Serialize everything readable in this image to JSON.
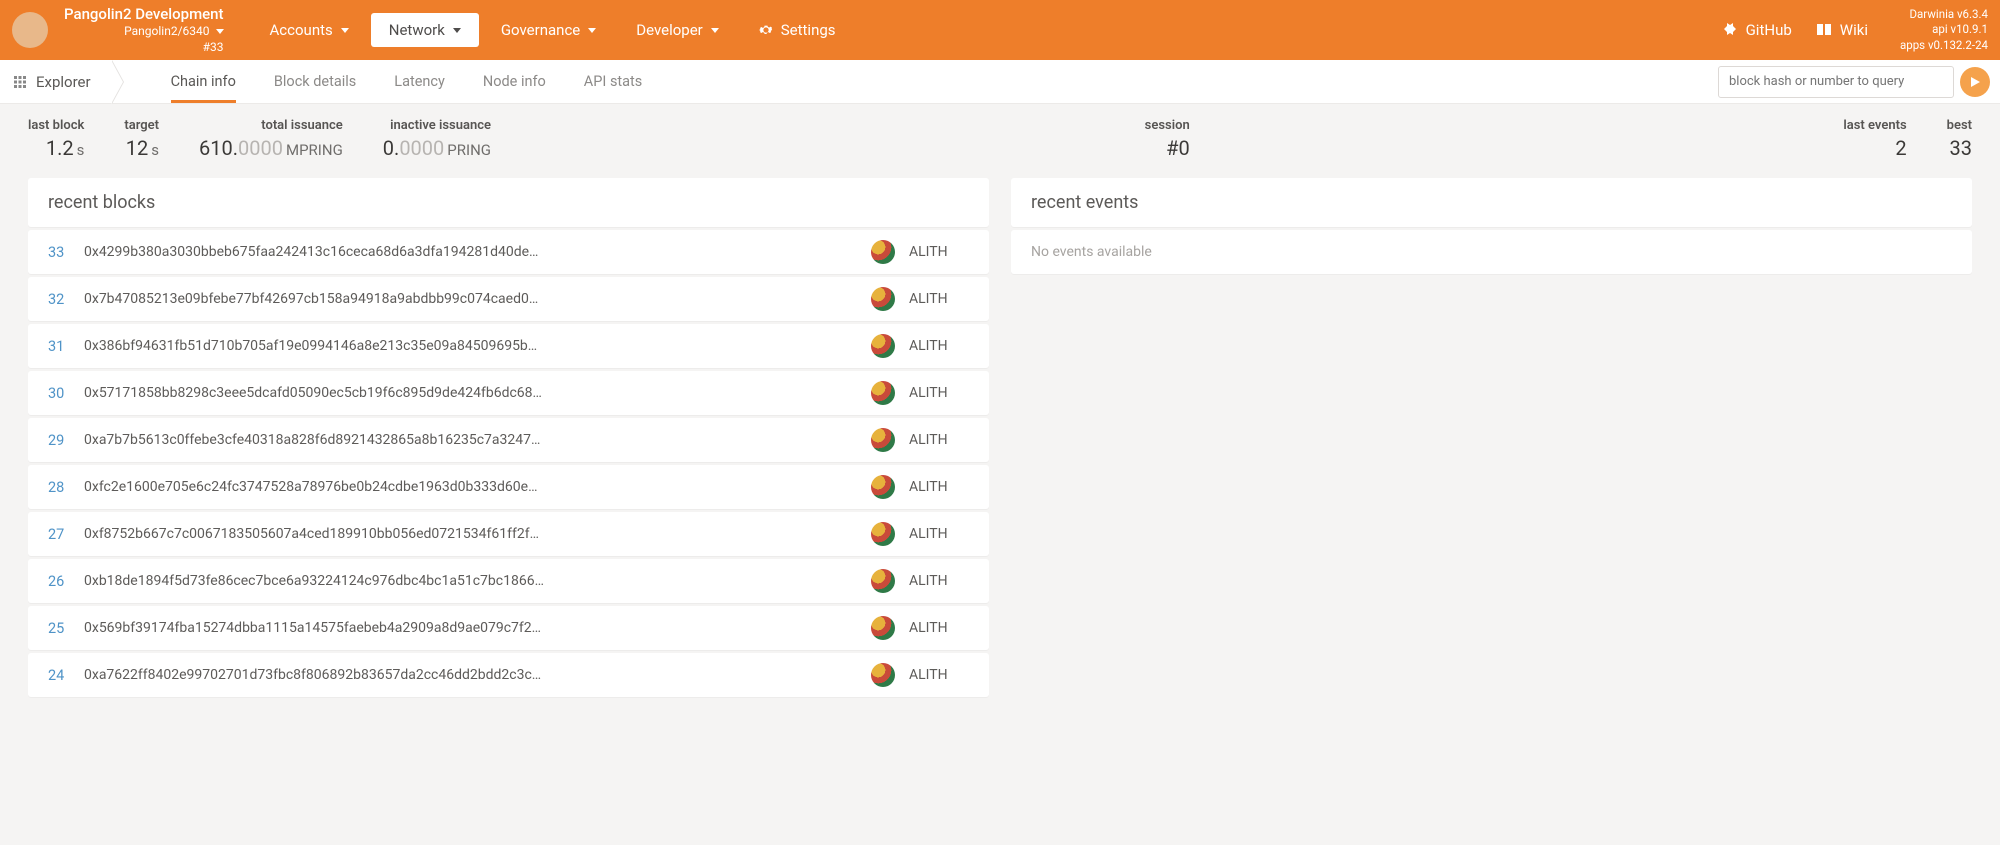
{
  "header": {
    "chainTitle": "Pangolin2 Development",
    "chainSub": "Pangolin2/6340",
    "chainBest": "#33",
    "nav": [
      {
        "label": "Accounts",
        "active": false,
        "caret": true
      },
      {
        "label": "Network",
        "active": true,
        "caret": true
      },
      {
        "label": "Governance",
        "active": false,
        "caret": true
      },
      {
        "label": "Developer",
        "active": false,
        "caret": true
      },
      {
        "label": "Settings",
        "active": false,
        "caret": false,
        "gear": true
      }
    ],
    "links": {
      "github": "GitHub",
      "wiki": "Wiki"
    },
    "version": {
      "l1": "Darwinia v6.3.4",
      "l2": "api v10.9.1",
      "l3": "apps v0.132.2-24"
    }
  },
  "subnav": {
    "explorer": "Explorer",
    "tabs": [
      {
        "label": "Chain info",
        "active": true
      },
      {
        "label": "Block details",
        "active": false
      },
      {
        "label": "Latency",
        "active": false
      },
      {
        "label": "Node info",
        "active": false
      },
      {
        "label": "API stats",
        "active": false
      }
    ],
    "searchPlaceholder": "block hash or number to query"
  },
  "stats": {
    "lastBlock": {
      "lbl": "last block",
      "main": "1.2",
      "unit": "s"
    },
    "target": {
      "lbl": "target",
      "main": "12",
      "unit": "s"
    },
    "totalIssuance": {
      "lbl": "total issuance",
      "main": "610.",
      "dim": "0000",
      "unit": "MPRING"
    },
    "inactiveIssuance": {
      "lbl": "inactive issuance",
      "main": "0.",
      "dim": "0000",
      "unit": "PRING"
    },
    "session": {
      "lbl": "session",
      "main": "#0"
    },
    "lastEvents": {
      "lbl": "last events",
      "main": "2"
    },
    "best": {
      "lbl": "best",
      "main": "33"
    }
  },
  "blocksTitle": "recent blocks",
  "eventsTitle": "recent events",
  "eventsEmpty": "No events available",
  "blocks": [
    {
      "n": "33",
      "hash": "0x4299b380a3030bbeb675faa242413c16ceca68d6a3dfa194281d40de…",
      "author": "ALITH"
    },
    {
      "n": "32",
      "hash": "0x7b47085213e09bfebe77bf42697cb158a94918a9abdbb99c074caed0…",
      "author": "ALITH"
    },
    {
      "n": "31",
      "hash": "0x386bf94631fb51d710b705af19e0994146a8e213c35e09a84509695b…",
      "author": "ALITH"
    },
    {
      "n": "30",
      "hash": "0x57171858bb8298c3eee5dcafd05090ec5cb19f6c895d9de424fb6dc68…",
      "author": "ALITH"
    },
    {
      "n": "29",
      "hash": "0xa7b7b5613c0ffebe3cfe40318a828f6d8921432865a8b16235c7a3247…",
      "author": "ALITH"
    },
    {
      "n": "28",
      "hash": "0xfc2e1600e705e6c24fc3747528a78976be0b24cdbe1963d0b333d60e…",
      "author": "ALITH"
    },
    {
      "n": "27",
      "hash": "0xf8752b667c7c0067183505607a4ced189910bb056ed0721534f61ff2f…",
      "author": "ALITH"
    },
    {
      "n": "26",
      "hash": "0xb18de1894f5d73fe86cec7bce6a93224124c976dbc4bc1a51c7bc1866…",
      "author": "ALITH"
    },
    {
      "n": "25",
      "hash": "0x569bf39174fba15274dbba1115a14575faebeb4a2909a8d9ae079c7f2…",
      "author": "ALITH"
    },
    {
      "n": "24",
      "hash": "0xa7622ff8402e99702701d73fbc8f806892b83657da2cc46dd2bdd2c3c…",
      "author": "ALITH"
    }
  ]
}
